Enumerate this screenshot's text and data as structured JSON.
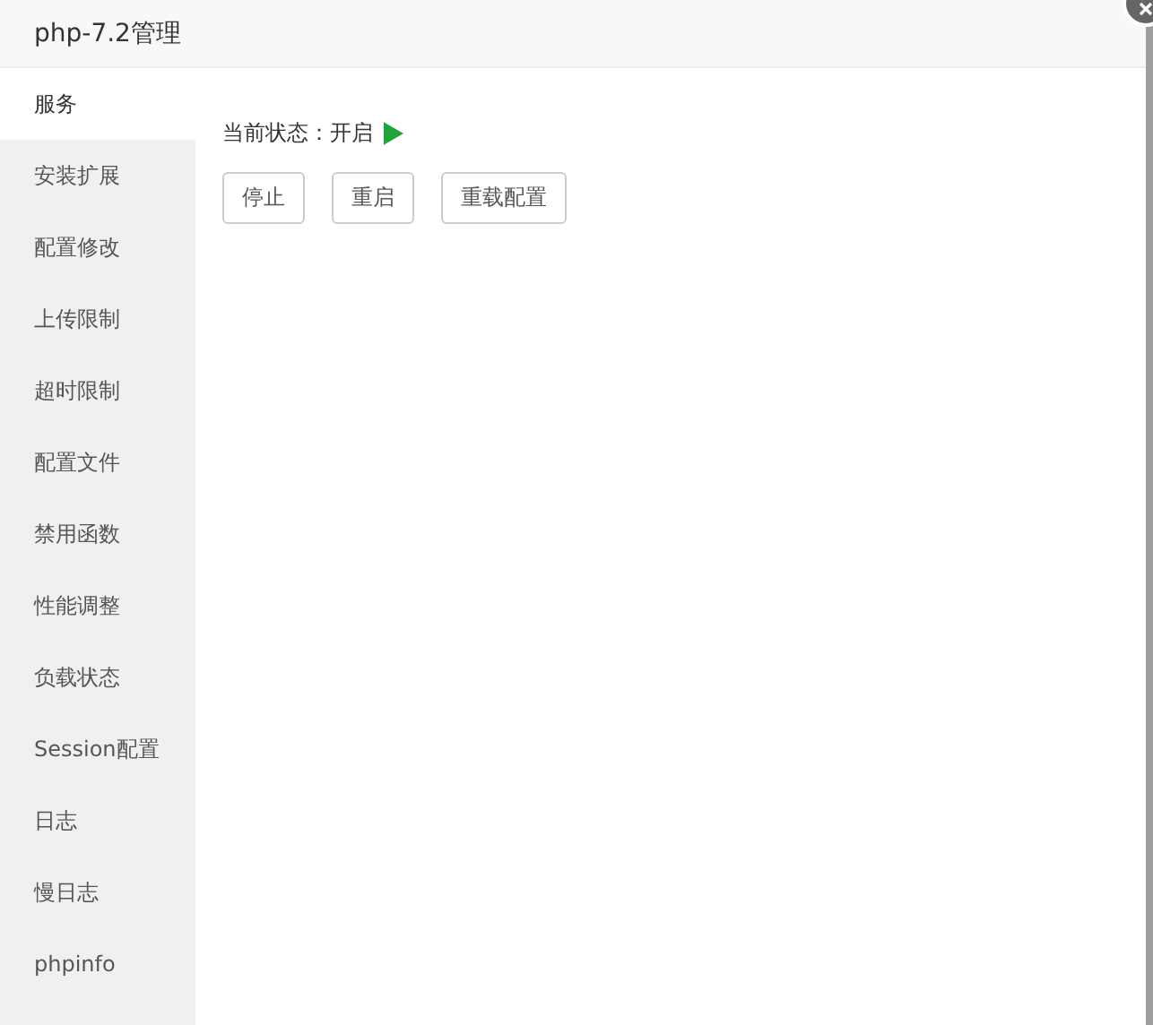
{
  "window": {
    "title": "php-7.2管理"
  },
  "sidebar": {
    "items": [
      {
        "label": "服务",
        "selected": true
      },
      {
        "label": "安装扩展",
        "selected": false
      },
      {
        "label": "配置修改",
        "selected": false
      },
      {
        "label": "上传限制",
        "selected": false
      },
      {
        "label": "超时限制",
        "selected": false
      },
      {
        "label": "配置文件",
        "selected": false
      },
      {
        "label": "禁用函数",
        "selected": false
      },
      {
        "label": "性能调整",
        "selected": false
      },
      {
        "label": "负载状态",
        "selected": false
      },
      {
        "label": "Session配置",
        "selected": false
      },
      {
        "label": "日志",
        "selected": false
      },
      {
        "label": "慢日志",
        "selected": false
      },
      {
        "label": "phpinfo",
        "selected": false
      }
    ]
  },
  "status": {
    "text": "当前状态：开启",
    "running": true
  },
  "buttons": [
    "停止",
    "重启",
    "重载配置"
  ]
}
